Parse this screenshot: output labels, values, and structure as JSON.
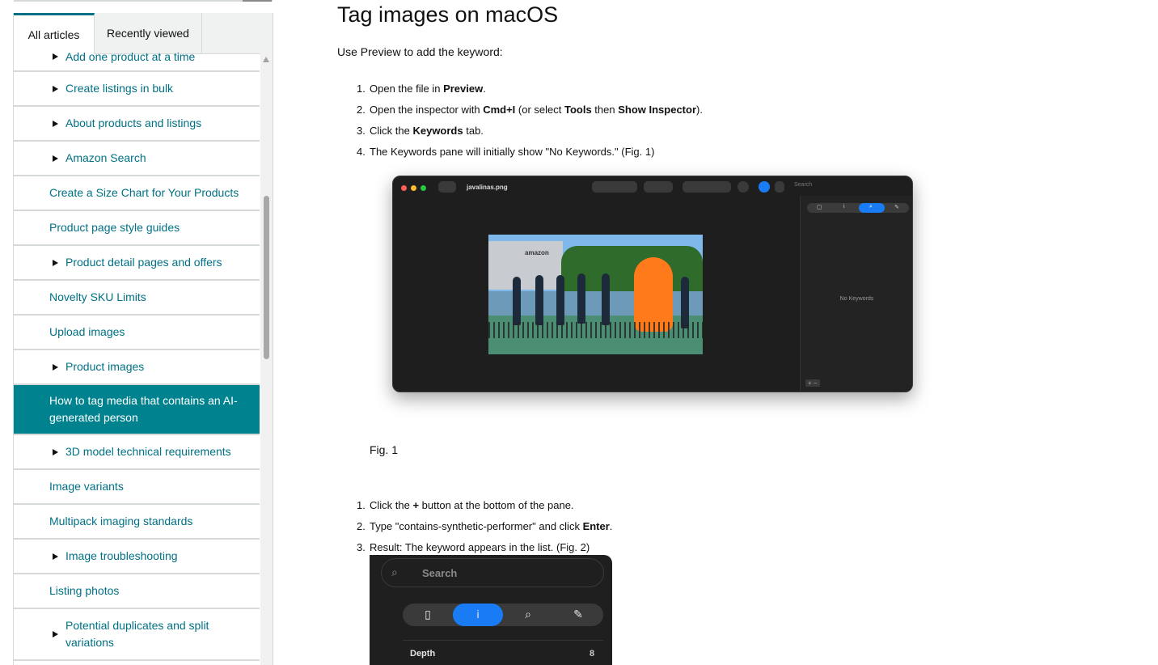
{
  "sidebar": {
    "tabs": [
      {
        "label": "All articles",
        "active": true
      },
      {
        "label": "Recently viewed",
        "active": false
      }
    ],
    "items": [
      {
        "label": "Add one product at a time",
        "arrow": true
      },
      {
        "label": "Create listings in bulk",
        "arrow": true
      },
      {
        "label": "About products and listings",
        "arrow": true
      },
      {
        "label": "Amazon Search",
        "arrow": true
      },
      {
        "label": "Create a Size Chart for Your Products",
        "arrow": false
      },
      {
        "label": "Product page style guides",
        "arrow": false
      },
      {
        "label": "Product detail pages and offers",
        "arrow": true
      },
      {
        "label": "Novelty SKU Limits",
        "arrow": false
      },
      {
        "label": "Upload images",
        "arrow": false
      },
      {
        "label": "Product images",
        "arrow": true
      },
      {
        "label": "How to tag media that contains an AI-generated person",
        "arrow": false,
        "selected": true
      },
      {
        "label": "3D model technical requirements",
        "arrow": true
      },
      {
        "label": "Image variants",
        "arrow": false
      },
      {
        "label": "Multipack imaging standards",
        "arrow": false
      },
      {
        "label": "Image troubleshooting",
        "arrow": true
      },
      {
        "label": "Listing photos",
        "arrow": false
      },
      {
        "label": "Potential duplicates and split variations",
        "arrow": true
      }
    ]
  },
  "article": {
    "title": "Tag images on macOS",
    "lead": "Use Preview to add the keyword:",
    "steps1": [
      {
        "num": "1.",
        "pre": "Open the file in ",
        "b1": "Preview",
        "mid": ".",
        "b2": "",
        "post": "",
        "b3": "",
        "end": ""
      },
      {
        "num": "2.",
        "pre": "Open the inspector with ",
        "b1": "Cmd+I",
        "mid": " (or select ",
        "b2": "Tools",
        "post": " then ",
        "b3": "Show Inspector",
        "end": ")."
      },
      {
        "num": "3.",
        "pre": "Click the ",
        "b1": "Keywords",
        "mid": " tab.",
        "b2": "",
        "post": "",
        "b3": "",
        "end": ""
      },
      {
        "num": "4.",
        "pre": "The Keywords pane will initially show \"No Keywords.\" (Fig. 1)",
        "b1": "",
        "mid": "",
        "b2": "",
        "post": "",
        "b3": "",
        "end": ""
      }
    ],
    "fig1_caption": "Fig. 1",
    "steps2": [
      {
        "num": "1.",
        "pre": "Click the ",
        "b1": "+",
        "mid": " button at the bottom of the pane."
      },
      {
        "num": "2.",
        "pre": "Type \"contains-synthetic-performer\" and click ",
        "b1": "Enter",
        "mid": "."
      },
      {
        "num": "3.",
        "pre": "Result: The keyword appears in the list. (Fig. 2)",
        "b1": "",
        "mid": ""
      }
    ]
  },
  "screenshot1": {
    "filename": "javalinas.png",
    "search_placeholder": "Search",
    "no_keywords": "No Keywords",
    "plus_minus": "+ −",
    "photo_sign": "amazon"
  },
  "screenshot2": {
    "search_placeholder": "Search",
    "depth_label": "Depth",
    "depth_value": "8"
  },
  "colors": {
    "link": "#007185",
    "selected_bg": "#00838f",
    "accent_blue": "#1a7cf5"
  }
}
